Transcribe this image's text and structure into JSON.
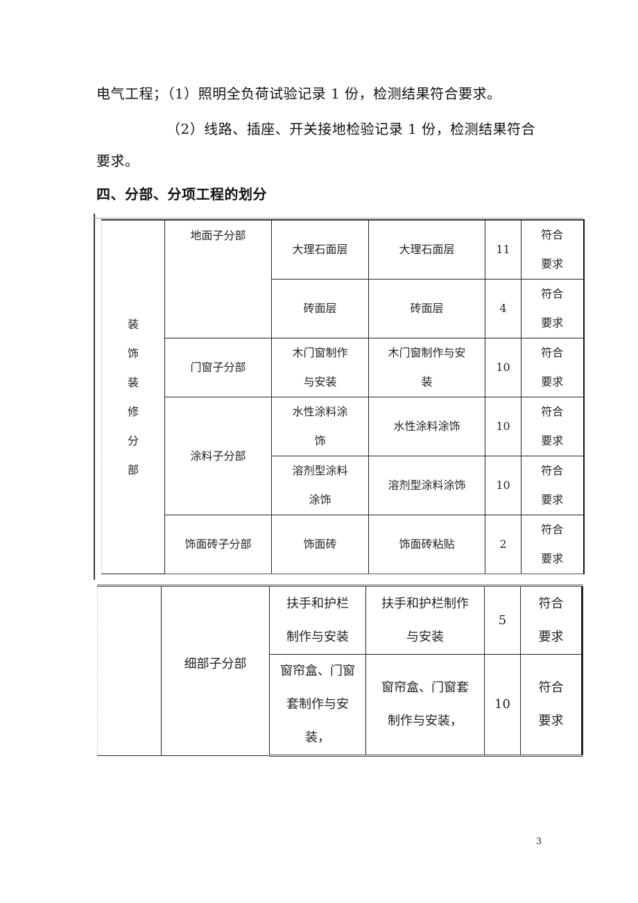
{
  "paragraphs": {
    "electrical_line1": "电气工程；（1）照明全负荷试验记录 1 份，检测结果符合要求。",
    "electrical_line2": "（2）线路、插座、开关接地检验记录 1 份，检测结果符合",
    "electrical_line3": "要求。"
  },
  "section_heading": "四、分部、分项工程的划分",
  "table1": {
    "division": [
      "装",
      "饰",
      "装",
      "修",
      "分",
      "部"
    ],
    "rows": [
      {
        "subdivision": "地面子分部",
        "item": "大理石面层",
        "content": "大理石面层",
        "count": "11",
        "result": [
          "符合",
          "要求"
        ]
      },
      {
        "subdivision": "",
        "item": "砖面层",
        "content": "砖面层",
        "count": "4",
        "result": [
          "符合",
          "要求"
        ]
      },
      {
        "subdivision": "门窗子分部",
        "item": [
          "木门窗制作",
          "与安装"
        ],
        "content": [
          "木门窗制作与安",
          "装"
        ],
        "count": "10",
        "result": [
          "符合",
          "要求"
        ]
      },
      {
        "subdivision": "涂料子分部",
        "item": [
          "水性涂料涂",
          "饰"
        ],
        "content": "水性涂料涂饰",
        "count": "10",
        "result": [
          "符合",
          "要求"
        ]
      },
      {
        "subdivision": "",
        "item": [
          "溶剂型涂料",
          "涂饰"
        ],
        "content": "溶剂型涂料涂饰",
        "count": "10",
        "result": [
          "符合",
          "要求"
        ]
      },
      {
        "subdivision": "饰面砖子分部",
        "item": "饰面砖",
        "content": "饰面砖粘贴",
        "count": "2",
        "result": [
          "符合",
          "要求"
        ]
      }
    ]
  },
  "table2": {
    "rows": [
      {
        "subdivision": "细部子分部",
        "item": [
          "扶手和护栏",
          "制作与安装"
        ],
        "content": [
          "扶手和护栏制作",
          "与安装"
        ],
        "count": "5",
        "result": [
          "符合",
          "要求"
        ]
      },
      {
        "subdivision": "",
        "item": [
          "窗帘盒、门窗",
          "套制作与安",
          "装，"
        ],
        "content": [
          "窗帘盒、门窗套",
          "制作与安装，"
        ],
        "count": "10",
        "result": [
          "符合",
          "要求"
        ]
      }
    ]
  },
  "page_number": "3"
}
